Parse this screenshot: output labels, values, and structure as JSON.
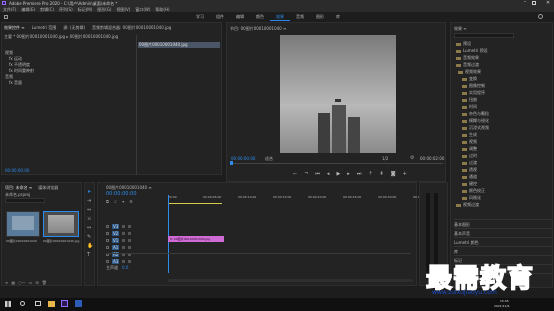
{
  "titlebar": {
    "title": "Adobe Premiere Pro 2020 - C:\\用户\\Admin\\桌面\\未命名 *"
  },
  "menubar": {
    "items": [
      "文件(F)",
      "编辑(E)",
      "剪辑(C)",
      "序列(S)",
      "标记(M)",
      "图形(G)",
      "视图(V)",
      "窗口(W)",
      "帮助(H)"
    ]
  },
  "workspaces": {
    "items": [
      "学习",
      "组件",
      "编辑",
      "颜色",
      "效果",
      "音频",
      "图形",
      "库"
    ],
    "active_index": 4
  },
  "source_panel": {
    "tabs": [
      "效果控件 ≡",
      "Lumetri 范围",
      "源: (无剪辑)",
      "音频剪辑混合器: 00图片00010001040.jpg"
    ],
    "header": "主要 * 00图片00010001040.jpg ▸ 00图片00010001040.jpg",
    "clip_label": "00图片00010001040.jpg",
    "items": [
      "视频",
      "fx 运动",
      "fx 不透明度",
      "fx 时间重映射",
      "音频",
      "fx 音量"
    ],
    "timecode": "00:00:00:00"
  },
  "program": {
    "title": "节目: 00图片00010001040 ≡",
    "timecode_left": "00:00:00:00",
    "fit": "适合",
    "ratio": "1/2",
    "timecode_right": "00:00:02:00"
  },
  "effects": {
    "title": "效果 ≡",
    "items": [
      "预设",
      "Lumetri 预设",
      "音频效果",
      "音频过渡",
      "视频效果",
      "变换",
      "图像控制",
      "实用程序",
      "扭曲",
      "时间",
      "杂色与颗粒",
      "模糊与锐化",
      "沉浸式视频",
      "生成",
      "视频",
      "调整",
      "过时",
      "过渡",
      "透视",
      "通道",
      "键控",
      "颜色校正",
      "风格化",
      "视频过渡"
    ],
    "sections": [
      "基本图形",
      "基本声音",
      "Lumetri 颜色",
      "库",
      "标记",
      "历史记录",
      "信息"
    ]
  },
  "project": {
    "tabs": [
      "项目: 未命名 ≡",
      "媒体浏览器"
    ],
    "name": "未命名.prproj",
    "search_placeholder": "",
    "bins": [
      {
        "label": "00图片00010001040",
        "meta": "5:00"
      },
      {
        "label": "00图片00010001040.jpg",
        "meta": "5:00"
      }
    ]
  },
  "timeline": {
    "title": "00图片00010001040 ≡",
    "timecode": "00:00:00:00",
    "ruler": [
      "00:00",
      "00:00:05:00",
      "00:00:10:00",
      "00:00:15:00",
      "00:00:20:00",
      "00:00:25:00",
      "00:00:30:00",
      "00:00:35:00"
    ],
    "tracks": [
      "V3",
      "V2",
      "V1",
      "A1",
      "A2",
      "A3"
    ],
    "master": "主声道",
    "master_val": "0.0",
    "clip": "fx 00图片00010001040.jpg"
  },
  "taskbar": {
    "time": "15:05",
    "date": "2021/11/6"
  },
  "watermark": {
    "text": "最需教育",
    "url": "www.zuixujiaoyu.com"
  },
  "colors": {
    "accent": "#2d8ceb",
    "clip": "#d06bd6",
    "watermark": "#1a4fd0"
  }
}
